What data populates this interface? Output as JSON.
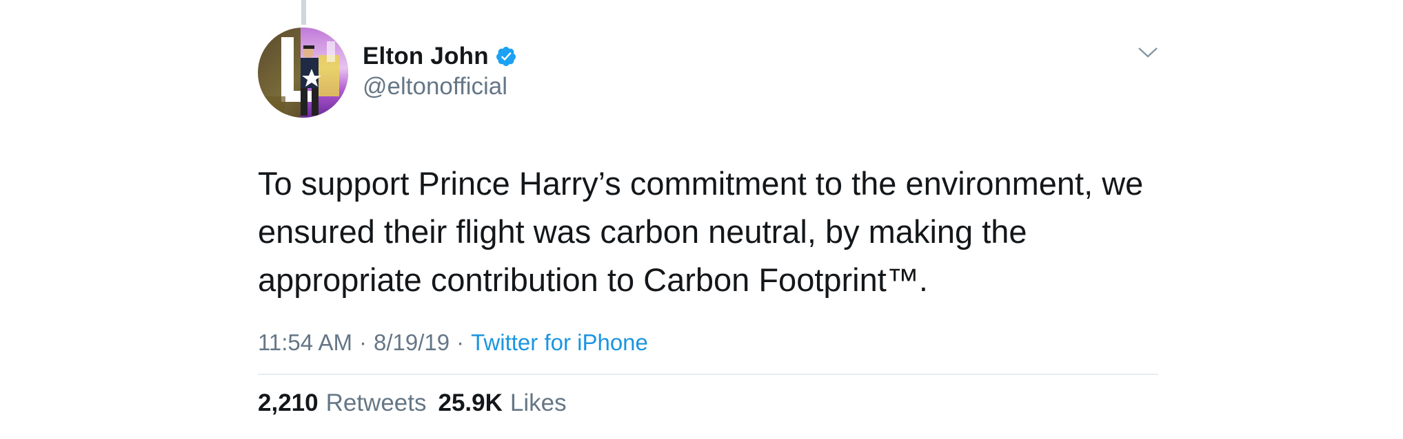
{
  "colors": {
    "text_primary": "#14171a",
    "text_secondary": "#657786",
    "link": "#1b95e0",
    "verified": "#1da1f2",
    "divider": "#e6ecf0"
  },
  "tweet": {
    "author": {
      "name": "Elton John",
      "handle": "@eltonofficial",
      "verified": true,
      "avatar_icon": "avatar-image"
    },
    "text": "To support Prince Harry’s commitment to the environment, we ensured their flight was carbon neutral, by making the appropriate contribution to Carbon Footprint™.",
    "time": "11:54 AM",
    "date": "8/19/19",
    "separator": "·",
    "source": "Twitter for iPhone",
    "stats": {
      "retweets_count": "2,210",
      "retweets_label": "Retweets",
      "likes_count": "25.9K",
      "likes_label": "Likes"
    }
  }
}
